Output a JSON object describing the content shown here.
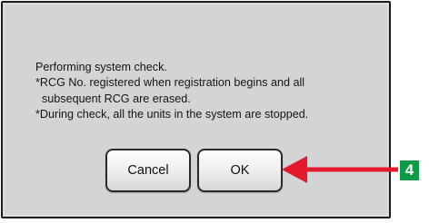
{
  "dialog": {
    "message_lines": [
      "Performing system check.",
      "*RCG No. registered when registration begins and all",
      "subsequent RCG are erased.",
      "*During check, all the units in the system are stopped."
    ],
    "cancel_label": "Cancel",
    "ok_label": "OK"
  },
  "annotation": {
    "step_number": "4",
    "arrow_color": "#e3192d",
    "badge_color": "#0f9a47"
  }
}
